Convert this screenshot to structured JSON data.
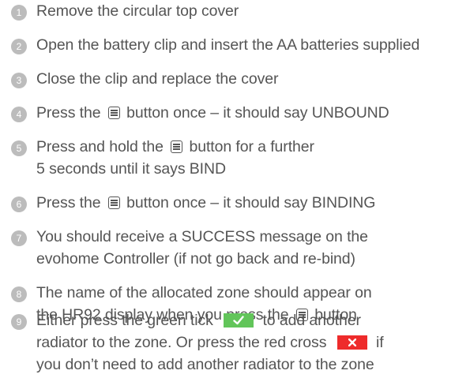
{
  "steps": [
    {
      "num": "1",
      "text": "Remove the circular top cover"
    },
    {
      "num": "2",
      "text": "Open the battery clip and insert the AA batteries supplied"
    },
    {
      "num": "3",
      "text": "Close the clip and replace the cover"
    },
    {
      "num": "4",
      "pre": "Press the",
      "post": "button once – it should say UNBOUND"
    },
    {
      "num": "5",
      "pre": "Press and hold the",
      "post": "button for a further",
      "line2": "5 seconds until it says BIND"
    },
    {
      "num": "6",
      "pre": "Press the",
      "post": "button once – it should say BINDING"
    },
    {
      "num": "7",
      "line1": "You should receive a SUCCESS message on the",
      "line2": "evohome Controller (if not go back and re-bind)"
    },
    {
      "num": "8",
      "line1": "The name of the allocated zone should appear on",
      "pre2": "the HR92 display when you press the",
      "post2": "button"
    },
    {
      "num": "9",
      "pre": "Either press the green tick",
      "post": "to add another",
      "pre2": "radiator to the zone. Or press the red cross",
      "post2": "if",
      "line3": "you don’t need to add another radiator to the zone"
    }
  ],
  "icons": {
    "menu": "menu-button-icon",
    "tick": "green-tick-icon",
    "cross": "red-cross-icon"
  },
  "colors": {
    "tick_bg": "#62c55a",
    "cross_bg": "#ee2b2b",
    "number_bg": "#bcbcbc",
    "text": "#555555"
  }
}
